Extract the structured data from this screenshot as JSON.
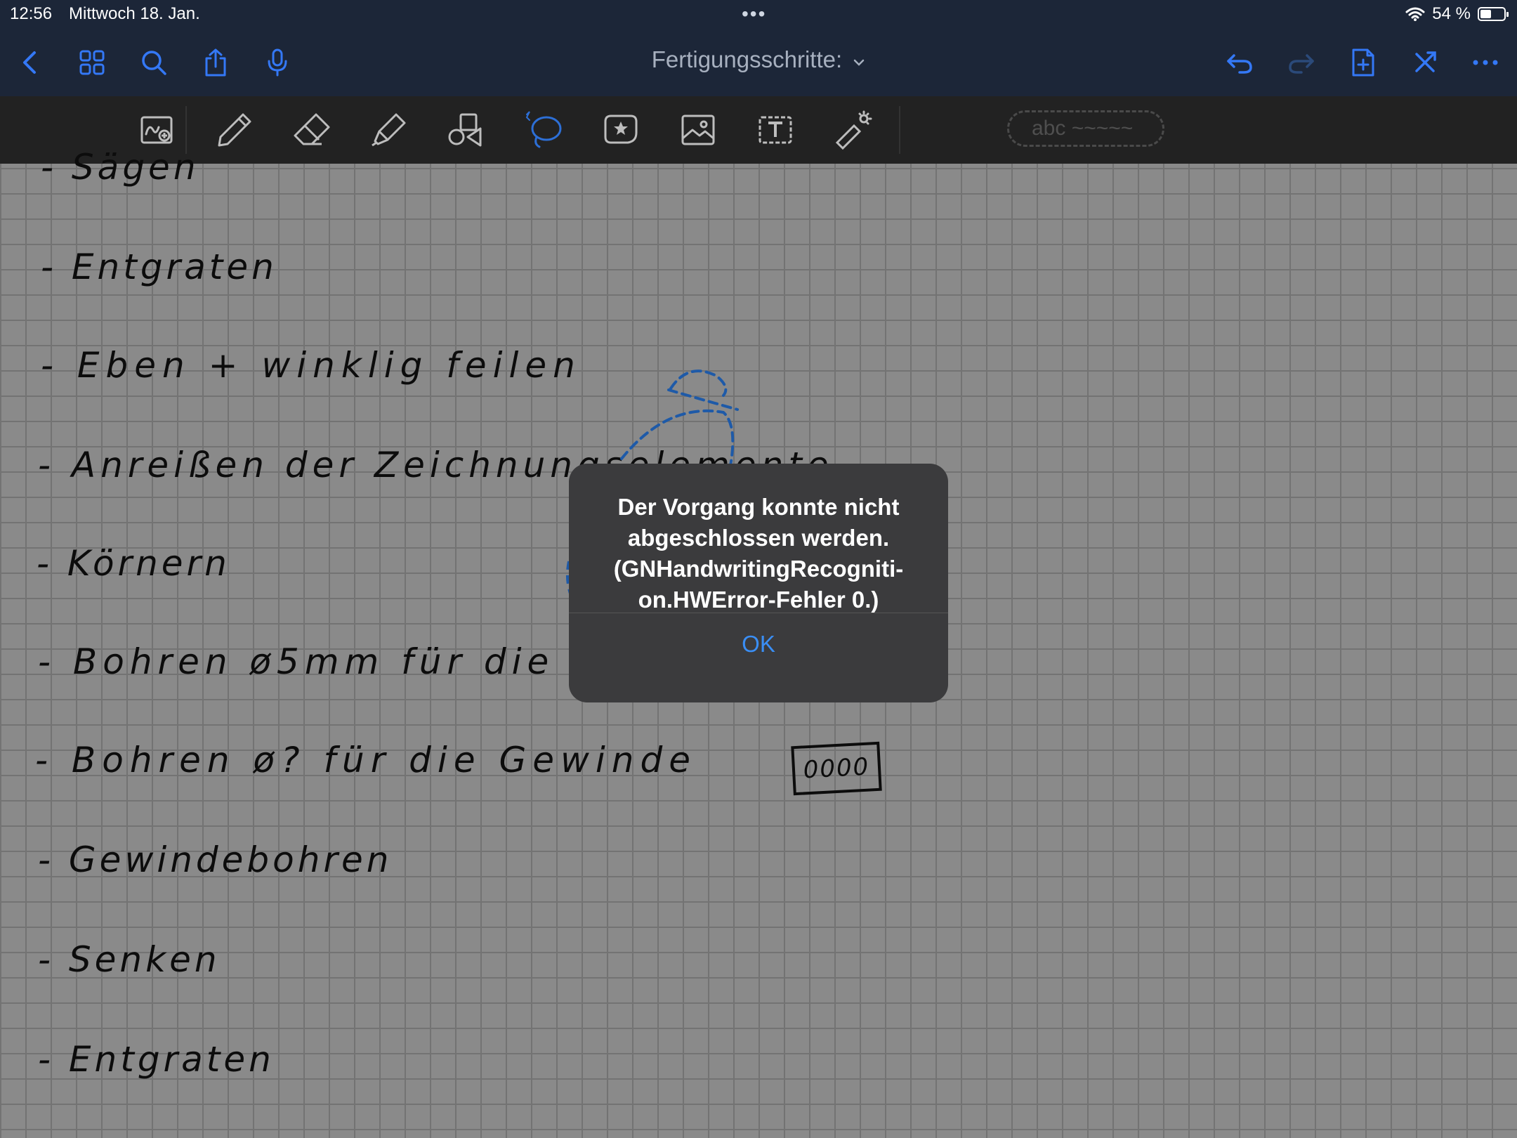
{
  "status": {
    "time": "12:56",
    "date": "Mittwoch 18. Jan.",
    "battery": "54 %",
    "battery_level": 0.54
  },
  "nav": {
    "title": "Fertigungsschritte:",
    "icons": [
      "back-icon",
      "grid-icon",
      "search-icon",
      "share-icon",
      "microphone-icon",
      "undo-icon",
      "redo-icon",
      "add-page-icon",
      "close-icon",
      "more-icon"
    ]
  },
  "toolbar": {
    "recognition_placeholder": "abc ~~~~~",
    "tools": [
      "zoom-window-icon",
      "pen-icon",
      "eraser-icon",
      "highlighter-icon",
      "shapes-icon",
      "lasso-icon",
      "sticker-icon",
      "image-icon",
      "text-icon",
      "laser-pointer-icon"
    ]
  },
  "note": {
    "lines": [
      "- Sägen",
      "- Entgraten",
      "- Eben + winklig feilen",
      "- Anreißen der Zeichnungselemente",
      "- Körnern",
      "- Bohren ø5mm für die",
      "- Bohren ø? für die Gewinde",
      "- Gewindebohren",
      "- Senken",
      "- Entgraten"
    ],
    "box_text": "0000"
  },
  "alert": {
    "message": "Der Vorgang konnte nicht abgeschlossen werden. (GNHandwritingRecogniti-on.HWError-Fehler 0.)",
    "ok_label": "OK"
  },
  "colors": {
    "bar": "#1c2638",
    "toolbar": "#222222",
    "accent": "#3a8ef5",
    "lasso": "#1e5aa8"
  }
}
